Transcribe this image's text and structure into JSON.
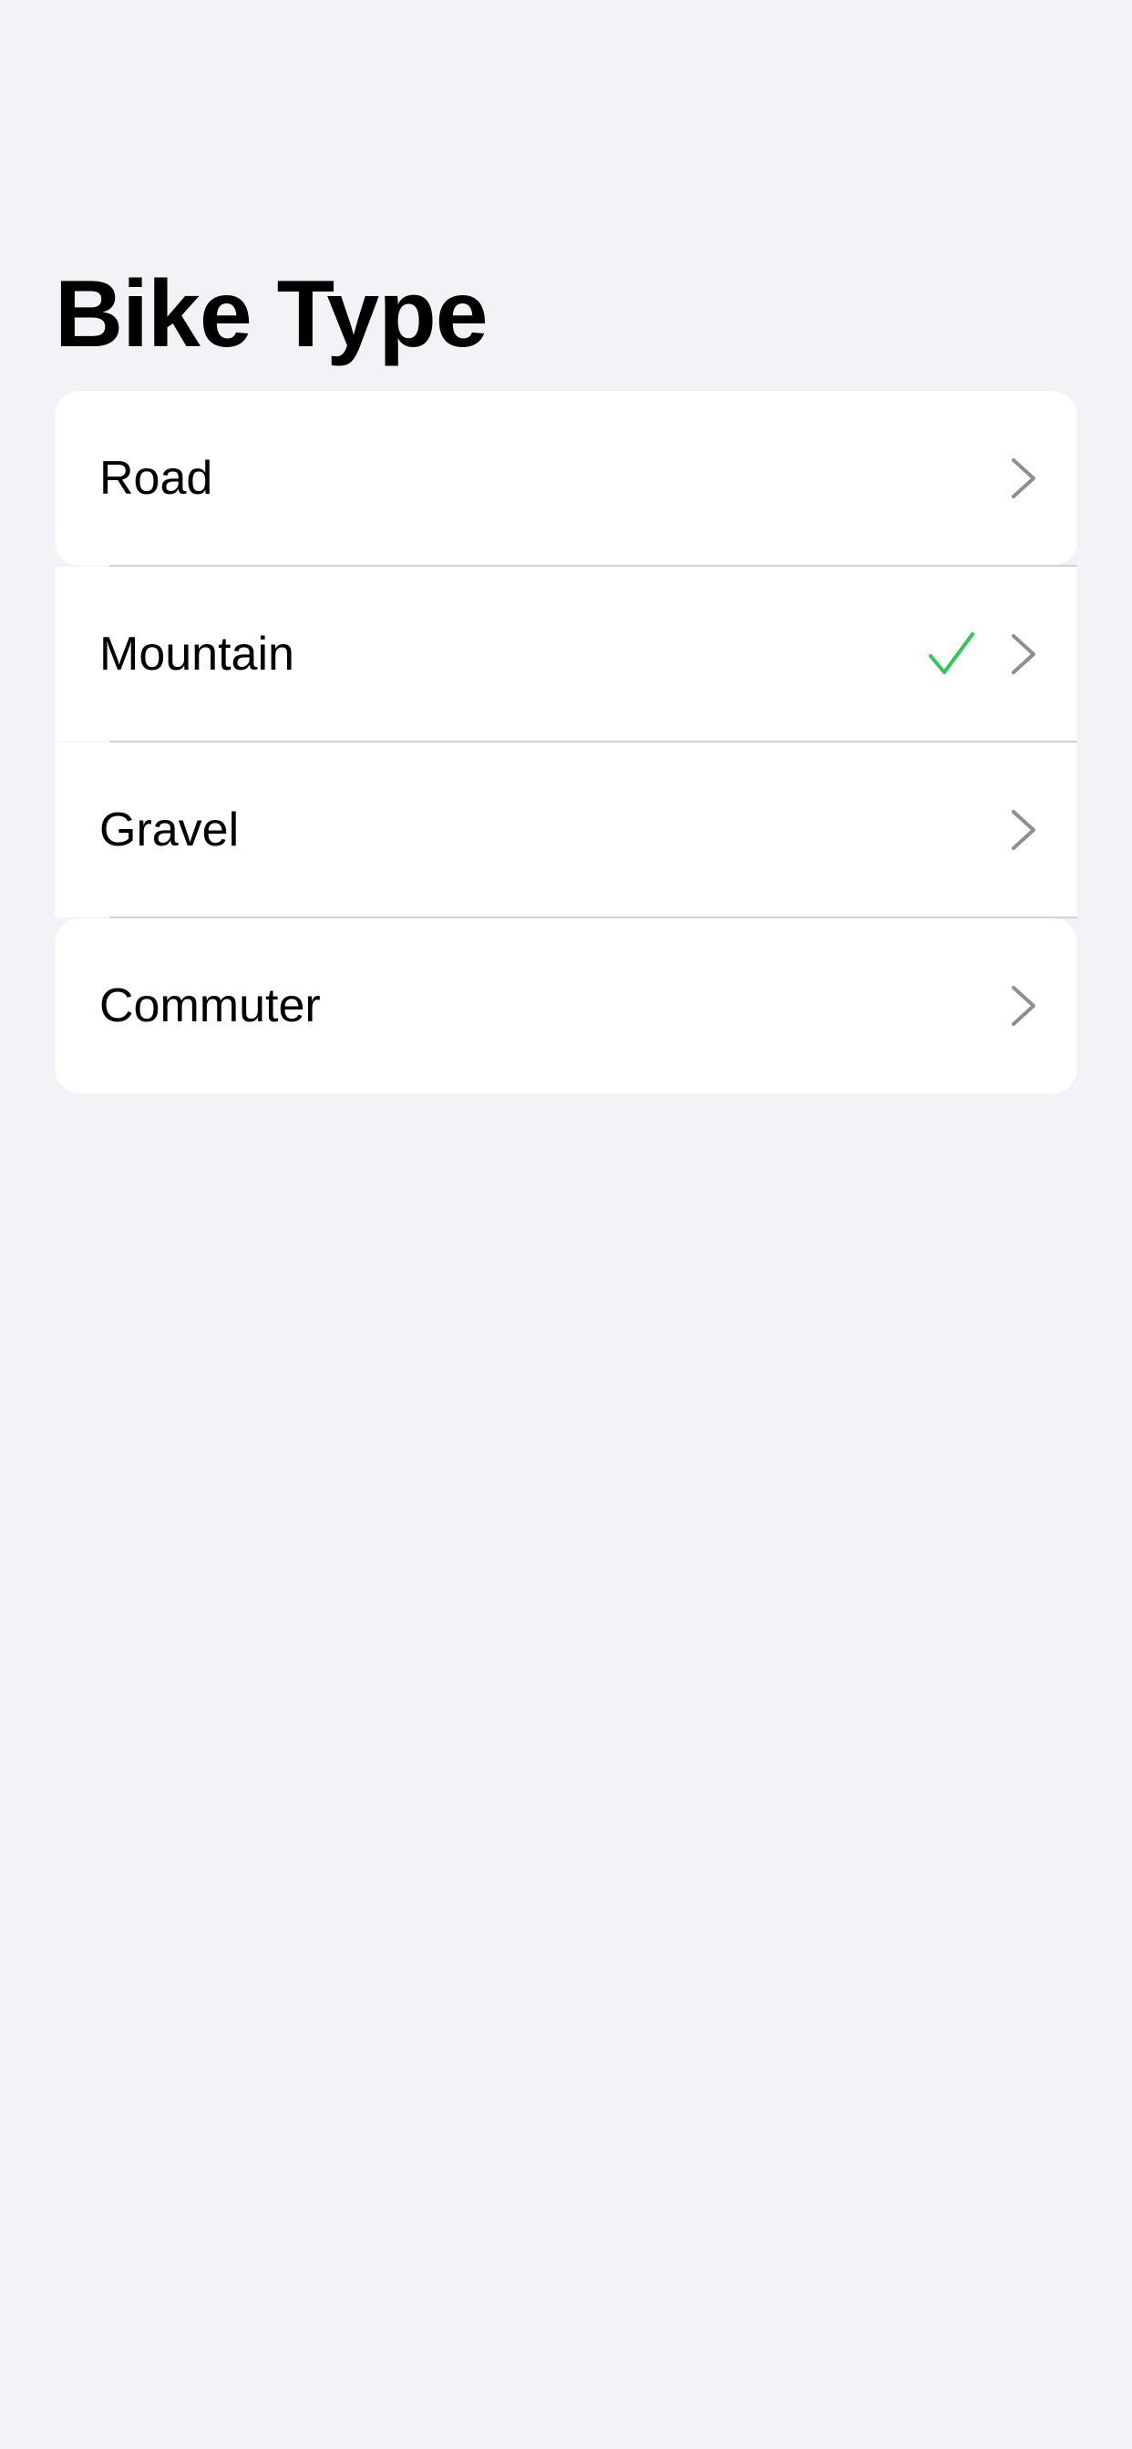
{
  "page": {
    "title": "Bike Type"
  },
  "options": [
    {
      "label": "Road",
      "selected": false
    },
    {
      "label": "Mountain",
      "selected": true
    },
    {
      "label": "Gravel",
      "selected": false
    },
    {
      "label": "Commuter",
      "selected": false
    }
  ],
  "colors": {
    "background": "#F2F2F7",
    "card": "#FFFFFF",
    "checkmark": "#34C759",
    "chevron": "#8E8E93",
    "separator": "#D1D1D6"
  }
}
